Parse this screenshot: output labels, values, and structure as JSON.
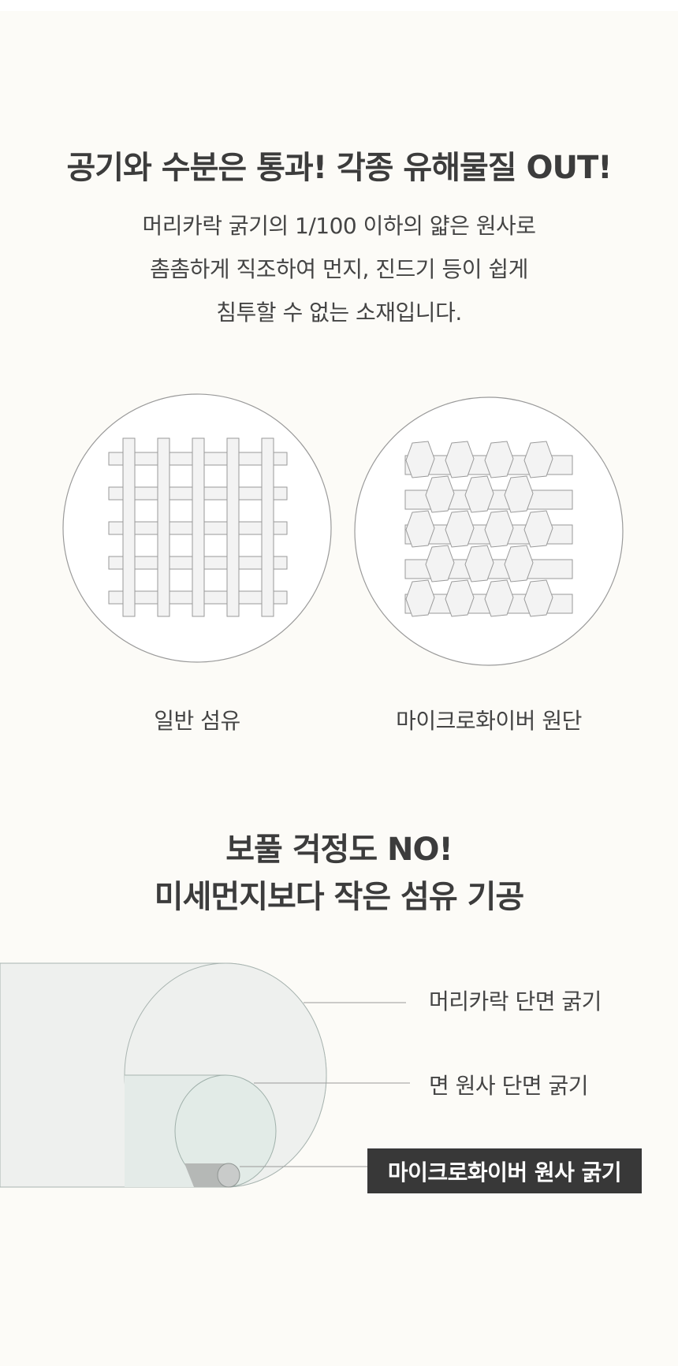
{
  "section1": {
    "title": "공기와 수분은 통과!  각종 유해물질 OUT!",
    "desc_lines": [
      "머리카락 굵기의 1/100 이하의 얇은 원사로",
      "촘촘하게 직조하여 먼지, 진드기 등이 쉽게",
      "침투할 수 없는 소재입니다."
    ],
    "fabrics": [
      {
        "icon": "regular-weave-icon",
        "caption": "일반 섬유"
      },
      {
        "icon": "microfiber-weave-icon",
        "caption": "마이크로화이버 원단"
      }
    ]
  },
  "section2": {
    "title_lines": [
      "보풀 걱정도 NO!",
      "미세먼지보다 작은 섬유 기공"
    ],
    "labels": [
      "머리카락 단면 굵기",
      "면 원사 단면 굵기",
      "마이크로화이버 원사 굵기"
    ]
  },
  "colors": {
    "background": "#fcfbf7",
    "text": "#3c3c3c",
    "tag_background": "#383838",
    "cylinder_fill": "#eef0ee"
  }
}
